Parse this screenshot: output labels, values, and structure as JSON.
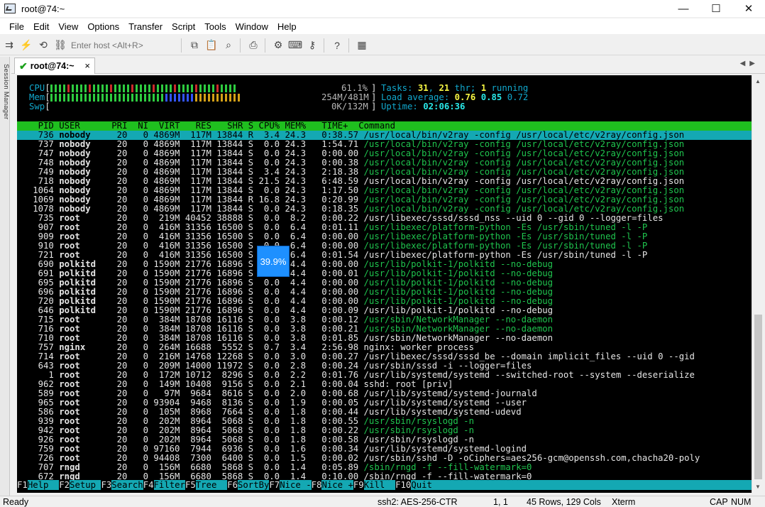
{
  "window": {
    "title": "root@74:~",
    "min": "—",
    "max": "☐",
    "close": "✕"
  },
  "menu": [
    "File",
    "Edit",
    "View",
    "Options",
    "Transfer",
    "Script",
    "Tools",
    "Window",
    "Help"
  ],
  "toolbar": {
    "host_placeholder": "Enter host <Alt+R>"
  },
  "session_manager_label": "Session Manager",
  "tab": {
    "label": "root@74:~",
    "close": "×"
  },
  "meters": {
    "cpu_label": "CPU",
    "cpu_pct": "61.1%",
    "mem_label": "Mem",
    "mem_val": "254M/481M",
    "swp_label": "Swp",
    "swp_val": "0K/132M",
    "tasks_label": "Tasks:",
    "tasks": "31",
    "thr": "21",
    "thr_label": "thr;",
    "running": "1",
    "running_label": "running",
    "load_label": "Load average:",
    "load1": "0.76",
    "load5": "0.85",
    "load15": "0.72",
    "uptime_label": "Uptime:",
    "uptime": "02:06:36"
  },
  "header": "    PID USER      PRI  NI  VIRT   RES   SHR S CPU% MEM%   TIME+  Command",
  "processes": [
    {
      "pid": "736",
      "user": "nobody",
      "pri": "20",
      "ni": "0",
      "virt": "4869M",
      "res": "117M",
      "shr": "13844",
      "s": "R",
      "cpu": "3.4",
      "mem": "24.3",
      "time": "0:38.57",
      "cmd": "/usr/local/bin/v2ray -config /usr/local/etc/v2ray/config.json",
      "dim": false,
      "sel": true
    },
    {
      "pid": "737",
      "user": "nobody",
      "pri": "20",
      "ni": "0",
      "virt": "4869M",
      "res": "117M",
      "shr": "13844",
      "s": "S",
      "cpu": "0.0",
      "mem": "24.3",
      "time": "1:54.71",
      "cmd": "/usr/local/bin/v2ray -config /usr/local/etc/v2ray/config.json",
      "dim": true
    },
    {
      "pid": "747",
      "user": "nobody",
      "pri": "20",
      "ni": "0",
      "virt": "4869M",
      "res": "117M",
      "shr": "13844",
      "s": "S",
      "cpu": "0.0",
      "mem": "24.3",
      "time": "0:00.00",
      "cmd": "/usr/local/bin/v2ray -config /usr/local/etc/v2ray/config.json",
      "dim": true
    },
    {
      "pid": "748",
      "user": "nobody",
      "pri": "20",
      "ni": "0",
      "virt": "4869M",
      "res": "117M",
      "shr": "13844",
      "s": "S",
      "cpu": "0.0",
      "mem": "24.3",
      "time": "0:00.38",
      "cmd": "/usr/local/bin/v2ray -config /usr/local/etc/v2ray/config.json",
      "dim": true
    },
    {
      "pid": "749",
      "user": "nobody",
      "pri": "20",
      "ni": "0",
      "virt": "4869M",
      "res": "117M",
      "shr": "13844",
      "s": "S",
      "cpu": "3.4",
      "mem": "24.3",
      "time": "2:18.38",
      "cmd": "/usr/local/bin/v2ray -config /usr/local/etc/v2ray/config.json",
      "dim": true
    },
    {
      "pid": "718",
      "user": "nobody",
      "pri": "20",
      "ni": "0",
      "virt": "4869M",
      "res": "117M",
      "shr": "13844",
      "s": "S",
      "cpu": "21.5",
      "mem": "24.3",
      "time": "6:48.59",
      "cmd": "/usr/local/bin/v2ray -config /usr/local/etc/v2ray/config.json",
      "dim": false
    },
    {
      "pid": "1064",
      "user": "nobody",
      "pri": "20",
      "ni": "0",
      "virt": "4869M",
      "res": "117M",
      "shr": "13844",
      "s": "S",
      "cpu": "0.0",
      "mem": "24.3",
      "time": "1:17.50",
      "cmd": "/usr/local/bin/v2ray -config /usr/local/etc/v2ray/config.json",
      "dim": true
    },
    {
      "pid": "1069",
      "user": "nobody",
      "pri": "20",
      "ni": "0",
      "virt": "4869M",
      "res": "117M",
      "shr": "13844",
      "s": "R",
      "cpu": "16.8",
      "mem": "24.3",
      "time": "0:20.99",
      "cmd": "/usr/local/bin/v2ray -config /usr/local/etc/v2ray/config.json",
      "dim": true
    },
    {
      "pid": "1078",
      "user": "nobody",
      "pri": "20",
      "ni": "0",
      "virt": "4869M",
      "res": "117M",
      "shr": "13844",
      "s": "S",
      "cpu": "0.0",
      "mem": "24.3",
      "time": "0:18.35",
      "cmd": "/usr/local/bin/v2ray -config /usr/local/etc/v2ray/config.json",
      "dim": true
    },
    {
      "pid": "735",
      "user": "root",
      "pri": "20",
      "ni": "0",
      "virt": "219M",
      "res": "40452",
      "shr": "38888",
      "s": "S",
      "cpu": "0.0",
      "mem": "8.2",
      "time": "0:00.22",
      "cmd": "/usr/libexec/sssd/sssd_nss --uid 0 --gid 0 --logger=files",
      "dim": false
    },
    {
      "pid": "907",
      "user": "root",
      "pri": "20",
      "ni": "0",
      "virt": "416M",
      "res": "31356",
      "shr": "16500",
      "s": "S",
      "cpu": "0.0",
      "mem": "6.4",
      "time": "0:01.11",
      "cmd": "/usr/libexec/platform-python -Es /usr/sbin/tuned -l -P",
      "dim": true
    },
    {
      "pid": "909",
      "user": "root",
      "pri": "20",
      "ni": "0",
      "virt": "416M",
      "res": "31356",
      "shr": "16500",
      "s": "S",
      "cpu": "0.0",
      "mem": "6.4",
      "time": "0:00.00",
      "cmd": "/usr/libexec/platform-python -Es /usr/sbin/tuned -l -P",
      "dim": true
    },
    {
      "pid": "910",
      "user": "root",
      "pri": "20",
      "ni": "0",
      "virt": "416M",
      "res": "31356",
      "shr": "16500",
      "s": "S",
      "cpu": "0.0",
      "mem": "6.4",
      "time": "0:00.00",
      "cmd": "/usr/libexec/platform-python -Es /usr/sbin/tuned -l -P",
      "dim": true
    },
    {
      "pid": "721",
      "user": "root",
      "pri": "20",
      "ni": "0",
      "virt": "416M",
      "res": "31356",
      "shr": "16500",
      "s": "S",
      "cpu": "0.0",
      "mem": "6.4",
      "time": "0:01.54",
      "cmd": "/usr/libexec/platform-python -Es /usr/sbin/tuned -l -P",
      "dim": false
    },
    {
      "pid": "690",
      "user": "polkitd",
      "pri": "20",
      "ni": "0",
      "virt": "1590M",
      "res": "21776",
      "shr": "16896",
      "s": "S",
      "cpu": "0.0",
      "mem": "4.4",
      "time": "0:00.00",
      "cmd": "/usr/lib/polkit-1/polkitd --no-debug",
      "dim": true
    },
    {
      "pid": "691",
      "user": "polkitd",
      "pri": "20",
      "ni": "0",
      "virt": "1590M",
      "res": "21776",
      "shr": "16896",
      "s": "S",
      "cpu": "0.0",
      "mem": "4.4",
      "time": "0:00.01",
      "cmd": "/usr/lib/polkit-1/polkitd --no-debug",
      "dim": true
    },
    {
      "pid": "695",
      "user": "polkitd",
      "pri": "20",
      "ni": "0",
      "virt": "1590M",
      "res": "21776",
      "shr": "16896",
      "s": "S",
      "cpu": "0.0",
      "mem": "4.4",
      "time": "0:00.00",
      "cmd": "/usr/lib/polkit-1/polkitd --no-debug",
      "dim": true
    },
    {
      "pid": "696",
      "user": "polkitd",
      "pri": "20",
      "ni": "0",
      "virt": "1590M",
      "res": "21776",
      "shr": "16896",
      "s": "S",
      "cpu": "0.0",
      "mem": "4.4",
      "time": "0:00.00",
      "cmd": "/usr/lib/polkit-1/polkitd --no-debug",
      "dim": true
    },
    {
      "pid": "720",
      "user": "polkitd",
      "pri": "20",
      "ni": "0",
      "virt": "1590M",
      "res": "21776",
      "shr": "16896",
      "s": "S",
      "cpu": "0.0",
      "mem": "4.4",
      "time": "0:00.00",
      "cmd": "/usr/lib/polkit-1/polkitd --no-debug",
      "dim": true
    },
    {
      "pid": "646",
      "user": "polkitd",
      "pri": "20",
      "ni": "0",
      "virt": "1590M",
      "res": "21776",
      "shr": "16896",
      "s": "S",
      "cpu": "0.0",
      "mem": "4.4",
      "time": "0:00.09",
      "cmd": "/usr/lib/polkit-1/polkitd --no-debug",
      "dim": false
    },
    {
      "pid": "715",
      "user": "root",
      "pri": "20",
      "ni": "0",
      "virt": "384M",
      "res": "18708",
      "shr": "16116",
      "s": "S",
      "cpu": "0.0",
      "mem": "3.8",
      "time": "0:00.12",
      "cmd": "/usr/sbin/NetworkManager --no-daemon",
      "dim": true
    },
    {
      "pid": "716",
      "user": "root",
      "pri": "20",
      "ni": "0",
      "virt": "384M",
      "res": "18708",
      "shr": "16116",
      "s": "S",
      "cpu": "0.0",
      "mem": "3.8",
      "time": "0:00.21",
      "cmd": "/usr/sbin/NetworkManager --no-daemon",
      "dim": true
    },
    {
      "pid": "710",
      "user": "root",
      "pri": "20",
      "ni": "0",
      "virt": "384M",
      "res": "18708",
      "shr": "16116",
      "s": "S",
      "cpu": "0.0",
      "mem": "3.8",
      "time": "0:01.85",
      "cmd": "/usr/sbin/NetworkManager --no-daemon",
      "dim": false
    },
    {
      "pid": "757",
      "user": "nginx",
      "pri": "20",
      "ni": "0",
      "virt": "264M",
      "res": "16688",
      "shr": "5552",
      "s": "S",
      "cpu": "0.7",
      "mem": "3.4",
      "time": "2:56.98",
      "cmd": "nginx: worker process",
      "dim": false
    },
    {
      "pid": "714",
      "user": "root",
      "pri": "20",
      "ni": "0",
      "virt": "216M",
      "res": "14768",
      "shr": "12268",
      "s": "S",
      "cpu": "0.0",
      "mem": "3.0",
      "time": "0:00.27",
      "cmd": "/usr/libexec/sssd/sssd_be --domain implicit_files --uid 0 --gid",
      "dim": false
    },
    {
      "pid": "643",
      "user": "root",
      "pri": "20",
      "ni": "0",
      "virt": "209M",
      "res": "14000",
      "shr": "11972",
      "s": "S",
      "cpu": "0.0",
      "mem": "2.8",
      "time": "0:00.24",
      "cmd": "/usr/sbin/sssd -i --logger=files",
      "dim": false
    },
    {
      "pid": "1",
      "user": "root",
      "pri": "20",
      "ni": "0",
      "virt": "172M",
      "res": "10712",
      "shr": "8296",
      "s": "S",
      "cpu": "0.0",
      "mem": "2.2",
      "time": "0:01.76",
      "cmd": "/usr/lib/systemd/systemd --switched-root --system --deserialize",
      "dim": false
    },
    {
      "pid": "962",
      "user": "root",
      "pri": "20",
      "ni": "0",
      "virt": "149M",
      "res": "10408",
      "shr": "9156",
      "s": "S",
      "cpu": "0.0",
      "mem": "2.1",
      "time": "0:00.04",
      "cmd": "sshd: root [priv]",
      "dim": false
    },
    {
      "pid": "589",
      "user": "root",
      "pri": "20",
      "ni": "0",
      "virt": "97M",
      "res": "9684",
      "shr": "8616",
      "s": "S",
      "cpu": "0.0",
      "mem": "2.0",
      "time": "0:00.68",
      "cmd": "/usr/lib/systemd/systemd-journald",
      "dim": false
    },
    {
      "pid": "965",
      "user": "root",
      "pri": "20",
      "ni": "0",
      "virt": "93904",
      "res": "9468",
      "shr": "8136",
      "s": "S",
      "cpu": "0.0",
      "mem": "1.9",
      "time": "0:00.05",
      "cmd": "/usr/lib/systemd/systemd --user",
      "dim": false
    },
    {
      "pid": "586",
      "user": "root",
      "pri": "20",
      "ni": "0",
      "virt": "105M",
      "res": "8968",
      "shr": "7664",
      "s": "S",
      "cpu": "0.0",
      "mem": "1.8",
      "time": "0:00.44",
      "cmd": "/usr/lib/systemd/systemd-udevd",
      "dim": false
    },
    {
      "pid": "939",
      "user": "root",
      "pri": "20",
      "ni": "0",
      "virt": "202M",
      "res": "8964",
      "shr": "5068",
      "s": "S",
      "cpu": "0.0",
      "mem": "1.8",
      "time": "0:00.55",
      "cmd": "/usr/sbin/rsyslogd -n",
      "dim": true
    },
    {
      "pid": "942",
      "user": "root",
      "pri": "20",
      "ni": "0",
      "virt": "202M",
      "res": "8964",
      "shr": "5068",
      "s": "S",
      "cpu": "0.0",
      "mem": "1.8",
      "time": "0:00.22",
      "cmd": "/usr/sbin/rsyslogd -n",
      "dim": true
    },
    {
      "pid": "926",
      "user": "root",
      "pri": "20",
      "ni": "0",
      "virt": "202M",
      "res": "8964",
      "shr": "5068",
      "s": "S",
      "cpu": "0.0",
      "mem": "1.8",
      "time": "0:00.58",
      "cmd": "/usr/sbin/rsyslogd -n",
      "dim": false
    },
    {
      "pid": "759",
      "user": "root",
      "pri": "20",
      "ni": "0",
      "virt": "97160",
      "res": "7944",
      "shr": "6936",
      "s": "S",
      "cpu": "0.0",
      "mem": "1.6",
      "time": "0:00.34",
      "cmd": "/usr/lib/systemd/systemd-logind",
      "dim": false
    },
    {
      "pid": "726",
      "user": "root",
      "pri": "20",
      "ni": "0",
      "virt": "94408",
      "res": "7300",
      "shr": "6400",
      "s": "S",
      "cpu": "0.0",
      "mem": "1.5",
      "time": "0:00.02",
      "cmd": "/usr/sbin/sshd -D -oCiphers=aes256-gcm@openssh.com,chacha20-poly",
      "dim": false
    },
    {
      "pid": "707",
      "user": "rngd",
      "pri": "20",
      "ni": "0",
      "virt": "156M",
      "res": "6680",
      "shr": "5868",
      "s": "S",
      "cpu": "0.0",
      "mem": "1.4",
      "time": "0:05.89",
      "cmd": "/sbin/rngd -f --fill-watermark=0",
      "dim": true
    },
    {
      "pid": "672",
      "user": "rngd",
      "pri": "20",
      "ni": "0",
      "virt": "156M",
      "res": "6680",
      "shr": "5868",
      "s": "S",
      "cpu": "0.0",
      "mem": "1.4",
      "time": "0:10.00",
      "cmd": "/sbin/rngd -f --fill-watermark=0",
      "dim": false
    }
  ],
  "fkeys": [
    {
      "k": "F1",
      "l": "Help  "
    },
    {
      "k": "F2",
      "l": "Setup "
    },
    {
      "k": "F3",
      "l": "Search"
    },
    {
      "k": "F4",
      "l": "Filter"
    },
    {
      "k": "F5",
      "l": "Tree  "
    },
    {
      "k": "F6",
      "l": "SortBy"
    },
    {
      "k": "F7",
      "l": "Nice -"
    },
    {
      "k": "F8",
      "l": "Nice +"
    },
    {
      "k": "F9",
      "l": "Kill  "
    },
    {
      "k": "F10",
      "l": "Quit"
    }
  ],
  "tooltip": "39.9%",
  "status": {
    "ready": "Ready",
    "cipher": "ssh2: AES-256-CTR",
    "pos": "1,   1",
    "size": "45 Rows, 129 Cols",
    "term": "Xterm",
    "cap": "CAP",
    "num": "NUM"
  }
}
